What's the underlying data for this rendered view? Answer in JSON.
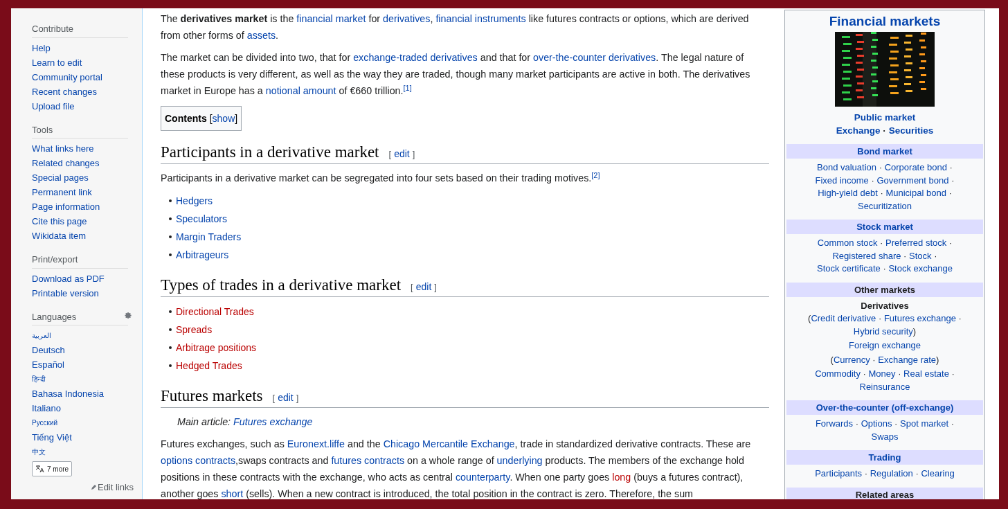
{
  "sidebar": {
    "sections": [
      {
        "heading": "Contribute",
        "items": [
          {
            "label": "Help"
          },
          {
            "label": "Learn to edit"
          },
          {
            "label": "Community portal"
          },
          {
            "label": "Recent changes"
          },
          {
            "label": "Upload file"
          }
        ]
      },
      {
        "heading": "Tools",
        "items": [
          {
            "label": "What links here"
          },
          {
            "label": "Related changes"
          },
          {
            "label": "Special pages"
          },
          {
            "label": "Permanent link"
          },
          {
            "label": "Page information"
          },
          {
            "label": "Cite this page"
          },
          {
            "label": "Wikidata item"
          }
        ]
      },
      {
        "heading": "Print/export",
        "items": [
          {
            "label": "Download as PDF"
          },
          {
            "label": "Printable version"
          }
        ]
      }
    ],
    "languages": {
      "heading": "Languages",
      "items": [
        {
          "label": "العربية",
          "small": true
        },
        {
          "label": "Deutsch",
          "small": false
        },
        {
          "label": "Español",
          "small": false
        },
        {
          "label": "हिन्दी",
          "small": true
        },
        {
          "label": "Bahasa Indonesia",
          "small": false
        },
        {
          "label": "Italiano",
          "small": false
        },
        {
          "label": "Русский",
          "small": true
        },
        {
          "label": "Tiếng Việt",
          "small": false
        },
        {
          "label": "中文",
          "small": true
        }
      ],
      "more_button": "7 more",
      "edit_links": "Edit links"
    }
  },
  "article": {
    "bracket_open": "[",
    "bracket_close": "]",
    "intro": [
      [
        {
          "kind": "text",
          "t": "The "
        },
        {
          "kind": "bold",
          "t": "derivatives market"
        },
        {
          "kind": "text",
          "t": " is the "
        },
        {
          "kind": "link",
          "t": "financial market"
        },
        {
          "kind": "text",
          "t": " for "
        },
        {
          "kind": "link",
          "t": "derivatives"
        },
        {
          "kind": "text",
          "t": ", "
        },
        {
          "kind": "link",
          "t": "financial instruments"
        },
        {
          "kind": "text",
          "t": " like futures contracts or options, which are derived from other forms of "
        },
        {
          "kind": "link",
          "t": "assets"
        },
        {
          "kind": "text",
          "t": "."
        }
      ],
      [
        {
          "kind": "text",
          "t": "The market can be divided into two, that for "
        },
        {
          "kind": "link",
          "t": "exchange-traded derivatives"
        },
        {
          "kind": "text",
          "t": " and that for "
        },
        {
          "kind": "link",
          "t": "over-the-counter derivatives"
        },
        {
          "kind": "text",
          "t": ". The legal nature of these products is very different, as well as the way they are traded, though many market participants are active in both. The derivatives market in Europe has a "
        },
        {
          "kind": "link",
          "t": "notional amount"
        },
        {
          "kind": "text",
          "t": " of €660 trillion."
        },
        {
          "kind": "ref",
          "t": "[1]"
        }
      ]
    ],
    "toc": {
      "label": "Contents",
      "toggle": "show"
    },
    "sections": [
      {
        "heading": "Participants in a derivative market",
        "edit": "edit",
        "paragraphs": [
          [
            {
              "kind": "text",
              "t": "Participants in a derivative market can be segregated into four sets based on their trading motives."
            },
            {
              "kind": "ref",
              "t": "[2]"
            }
          ]
        ],
        "bullets": [
          {
            "label": "Hedgers",
            "kind": "link"
          },
          {
            "label": "Speculators",
            "kind": "link"
          },
          {
            "label": "Margin Traders",
            "kind": "link"
          },
          {
            "label": "Arbitrageurs",
            "kind": "link"
          }
        ]
      },
      {
        "heading": "Types of trades in a derivative market",
        "edit": "edit",
        "bullets": [
          {
            "label": "Directional Trades",
            "kind": "redlink"
          },
          {
            "label": "Spreads",
            "kind": "redlink"
          },
          {
            "label": "Arbitrage positions",
            "kind": "redlink"
          },
          {
            "label": "Hedged Trades",
            "kind": "redlink"
          }
        ]
      },
      {
        "heading": "Futures markets",
        "edit": "edit",
        "main_article": [
          {
            "kind": "text",
            "t": "Main article: "
          },
          {
            "kind": "link",
            "t": "Futures exchange"
          }
        ],
        "paragraphs": [
          [
            {
              "kind": "text",
              "t": "Futures exchanges, such as "
            },
            {
              "kind": "link",
              "t": "Euronext.liffe"
            },
            {
              "kind": "text",
              "t": " and the "
            },
            {
              "kind": "link",
              "t": "Chicago Mercantile Exchange"
            },
            {
              "kind": "text",
              "t": ", trade in standardized derivative contracts. These are "
            },
            {
              "kind": "link",
              "t": "options contracts"
            },
            {
              "kind": "text",
              "t": ",swaps contracts and "
            },
            {
              "kind": "link",
              "t": "futures contracts"
            },
            {
              "kind": "text",
              "t": " on a whole range of "
            },
            {
              "kind": "link",
              "t": "underlying"
            },
            {
              "kind": "text",
              "t": " products. The members of the exchange hold positions in these contracts with the exchange, who acts as central "
            },
            {
              "kind": "link",
              "t": "counterparty"
            },
            {
              "kind": "text",
              "t": ". When one party goes "
            },
            {
              "kind": "redlink",
              "t": "long"
            },
            {
              "kind": "text",
              "t": " (buys a futures contract), another goes "
            },
            {
              "kind": "link",
              "t": "short"
            },
            {
              "kind": "text",
              "t": " (sells). When a new contract is introduced, the total position in the contract is zero. Therefore, the sum"
            }
          ]
        ]
      }
    ]
  },
  "infobox": {
    "title": "Financial markets",
    "separator": "·",
    "top_links": [
      [
        {
          "label": "Public market"
        }
      ],
      [
        {
          "label": "Exchange"
        },
        {
          "label": "Securities"
        }
      ]
    ],
    "sections": [
      {
        "heading": "Bond market",
        "heading_link": true,
        "blocks": [
          {
            "items": [
              "Bond valuation",
              "Corporate bond",
              "Fixed income",
              "Government bond",
              "High-yield debt",
              "Municipal bond",
              "Securitization"
            ]
          }
        ]
      },
      {
        "heading": "Stock market",
        "heading_link": true,
        "blocks": [
          {
            "items": [
              "Common stock",
              "Preferred stock",
              "Registered share",
              "Stock",
              "Stock certificate",
              "Stock exchange"
            ]
          }
        ]
      },
      {
        "heading": "Other markets",
        "heading_link": false,
        "blocks": [
          {
            "title": "Derivatives",
            "open": "(",
            "close": ")",
            "items": [
              "Credit derivative",
              "Futures exchange",
              "Hybrid security"
            ]
          },
          {
            "items": [
              "Foreign exchange"
            ]
          },
          {
            "open": "(",
            "close": ")",
            "items": [
              "Currency",
              "Exchange rate"
            ]
          },
          {
            "items": [
              "Commodity",
              "Money",
              "Real estate",
              "Reinsurance"
            ]
          }
        ]
      },
      {
        "heading": "Over-the-counter (off-exchange)",
        "heading_link": true,
        "blocks": [
          {
            "items": [
              "Forwards",
              "Options",
              "Spot market",
              "Swaps"
            ]
          }
        ]
      },
      {
        "heading": "Trading",
        "heading_link": true,
        "blocks": [
          {
            "items": [
              "Participants",
              "Regulation",
              "Clearing"
            ]
          }
        ]
      },
      {
        "heading": "Related areas",
        "heading_link": false
      }
    ]
  }
}
